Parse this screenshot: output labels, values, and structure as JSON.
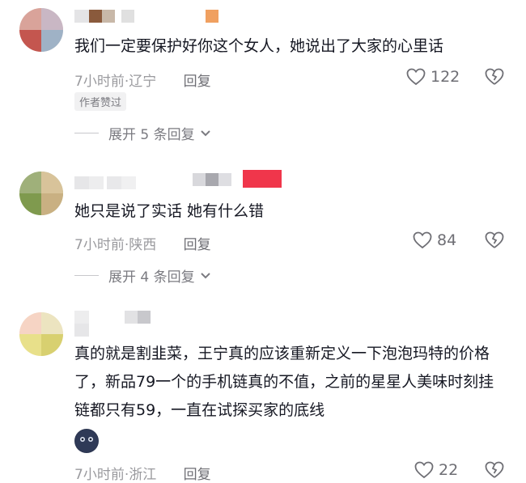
{
  "comments": [
    {
      "text": "我们一定要保护好你这个女人，她说出了大家的心里话",
      "time": "7小时前",
      "location": "辽宁",
      "reply_label": "回复",
      "likes": "122",
      "badge": "作者赞过",
      "expand_label": "展开 5 条回复"
    },
    {
      "text": "她只是说了实话 她有什么错",
      "time": "7小时前",
      "location": "陕西",
      "reply_label": "回复",
      "likes": "84",
      "expand_label": "展开 4 条回复"
    },
    {
      "text": "真的就是割韭菜，王宁真的应该重新定义一下泡泡玛特的价格了，新品79一个的手机链真的不值，之前的星星人美味时刻挂链都只有59，一直在试探买家的底线",
      "time": "7小时前",
      "location": "浙江",
      "reply_label": "回复",
      "likes": "22"
    }
  ],
  "meta_separator": "·",
  "icons": {
    "like": "heart-icon",
    "dislike": "broken-heart-icon",
    "expand": "chevron-down-icon"
  },
  "colors": {
    "text": "#161823",
    "meta": "#9a9a9e",
    "accent_red": "#f0364b"
  }
}
